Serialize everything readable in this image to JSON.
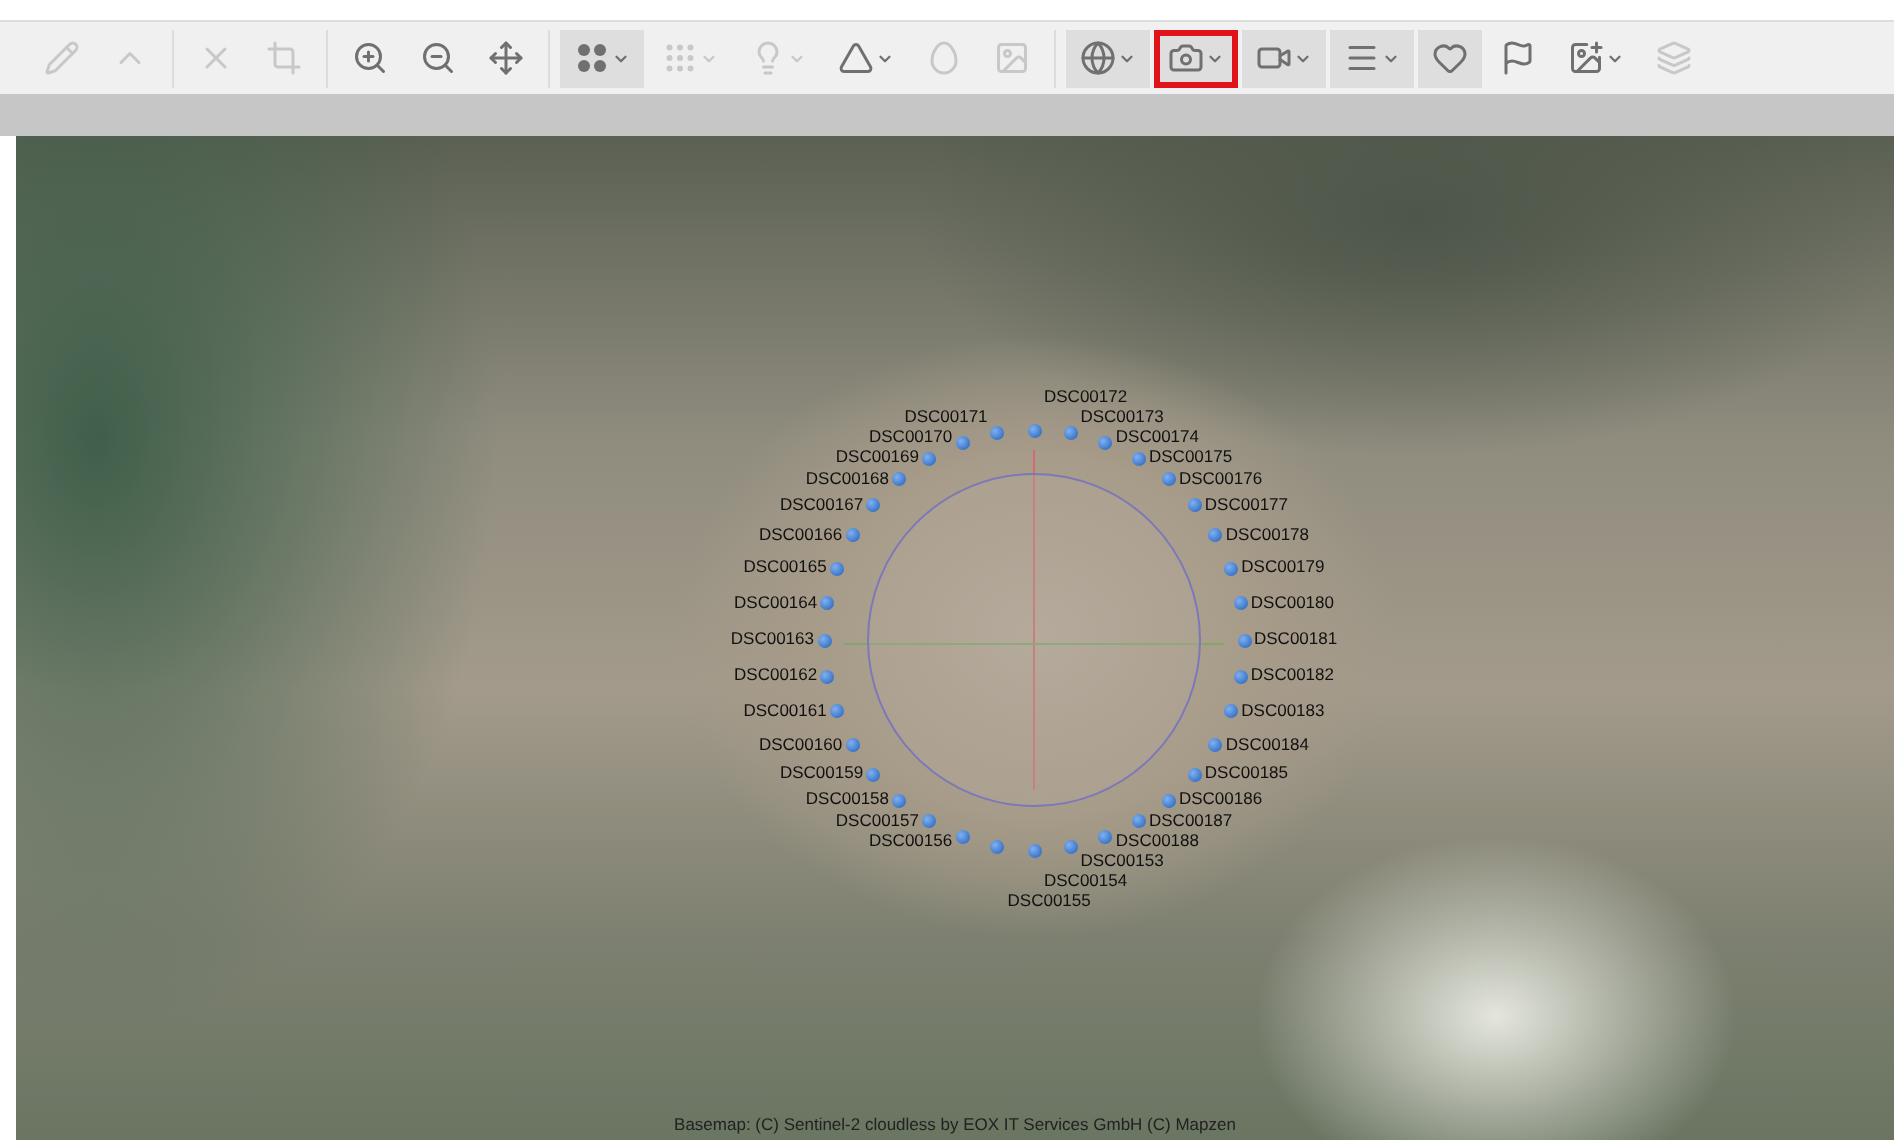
{
  "toolbar": {
    "groups": [
      [
        {
          "kind": "pencil",
          "selected": false,
          "disabled": true,
          "has_menu": false,
          "highlighted": false
        },
        {
          "kind": "line",
          "selected": false,
          "disabled": true,
          "has_menu": false,
          "highlighted": false
        }
      ],
      [
        {
          "kind": "delete",
          "selected": false,
          "disabled": true,
          "has_menu": false,
          "highlighted": false
        },
        {
          "kind": "crop",
          "selected": false,
          "disabled": true,
          "has_menu": false,
          "highlighted": false
        }
      ],
      [
        {
          "kind": "zoom-in",
          "selected": false,
          "disabled": false,
          "has_menu": false,
          "highlighted": false
        },
        {
          "kind": "zoom-out",
          "selected": false,
          "disabled": false,
          "has_menu": false,
          "highlighted": false
        },
        {
          "kind": "fit",
          "selected": false,
          "disabled": false,
          "has_menu": false,
          "highlighted": false
        }
      ],
      [
        {
          "kind": "dots",
          "selected": true,
          "disabled": false,
          "has_menu": true,
          "highlighted": false
        },
        {
          "kind": "grid",
          "selected": false,
          "disabled": true,
          "has_menu": true,
          "highlighted": false
        },
        {
          "kind": "light",
          "selected": false,
          "disabled": true,
          "has_menu": true,
          "highlighted": false
        },
        {
          "kind": "pyramid",
          "selected": false,
          "disabled": false,
          "has_menu": true,
          "highlighted": false
        },
        {
          "kind": "shape",
          "selected": false,
          "disabled": true,
          "has_menu": false,
          "highlighted": false
        },
        {
          "kind": "image",
          "selected": false,
          "disabled": true,
          "has_menu": false,
          "highlighted": false
        }
      ],
      [
        {
          "kind": "globe",
          "selected": true,
          "disabled": false,
          "has_menu": true,
          "highlighted": false
        },
        {
          "kind": "camera",
          "selected": true,
          "disabled": false,
          "has_menu": true,
          "highlighted": true
        },
        {
          "kind": "tripod",
          "selected": true,
          "disabled": false,
          "has_menu": true,
          "highlighted": false
        },
        {
          "kind": "list",
          "selected": true,
          "disabled": false,
          "has_menu": true,
          "highlighted": false
        },
        {
          "kind": "heart",
          "selected": true,
          "disabled": false,
          "has_menu": false,
          "highlighted": false
        },
        {
          "kind": "flag",
          "selected": false,
          "disabled": false,
          "has_menu": false,
          "highlighted": false
        },
        {
          "kind": "picture",
          "selected": false,
          "disabled": false,
          "has_menu": true,
          "highlighted": false
        },
        {
          "kind": "layers",
          "selected": false,
          "disabled": true,
          "has_menu": false,
          "highlighted": false
        }
      ]
    ]
  },
  "viewer": {
    "photos": [
      "DSC00172",
      "DSC00173",
      "DSC00174",
      "DSC00175",
      "DSC00176",
      "DSC00177",
      "DSC00178",
      "DSC00179",
      "DSC00180",
      "DSC00181",
      "DSC00182",
      "DSC00183",
      "DSC00184",
      "DSC00185",
      "DSC00186",
      "DSC00187",
      "DSC00188",
      "DSC00153",
      "DSC00154",
      "DSC00155",
      "DSC00171",
      "DSC00170",
      "DSC00169",
      "DSC00168",
      "DSC00167",
      "DSC00166",
      "DSC00165",
      "DSC00164",
      "DSC00163",
      "DSC00162",
      "DSC00161",
      "DSC00160",
      "DSC00159",
      "DSC00158",
      "DSC00157",
      "DSC00156"
    ],
    "attribution": "Basemap: (C) Sentinel-2 cloudless by EOX IT Services GmbH (C) Mapzen"
  }
}
